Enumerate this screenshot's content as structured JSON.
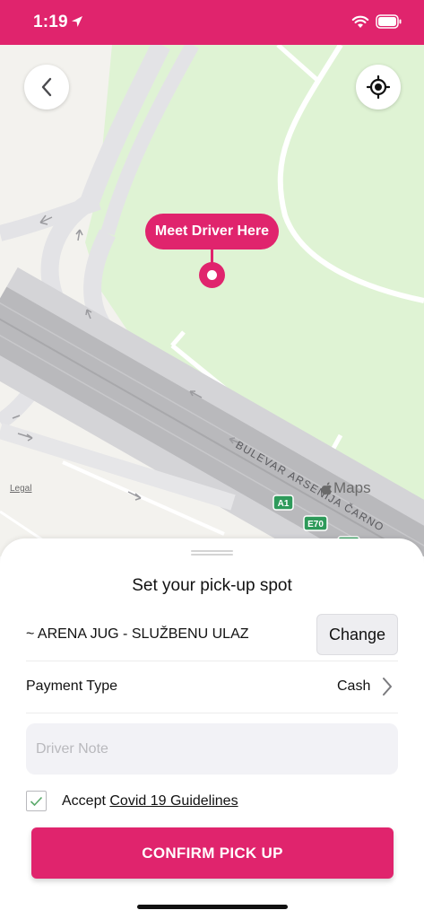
{
  "status_bar": {
    "time": "1:19",
    "background_color": "#e0246d"
  },
  "map": {
    "marker_label": "Meet Driver Here",
    "legal_label": "Legal",
    "brand_label": "Maps",
    "road_label": "BULEVAR ARSENIJA ČARNO",
    "road_shields": [
      "A1",
      "E70"
    ],
    "back_icon": "chevron-left-icon",
    "locate_icon": "crosshair-icon",
    "colors": {
      "park": "#dff3d4",
      "land": "#f3f2ee",
      "highway": "#bdbdc0",
      "road": "#e6e6e8"
    }
  },
  "sheet": {
    "title": "Set your pick-up spot",
    "pickup_spot": "~ ARENA JUG - SLUŽBENU ULAZ",
    "change_label": "Change",
    "payment_label": "Payment Type",
    "payment_value": "Cash",
    "driver_note": {
      "value": "",
      "placeholder": "Driver Note"
    },
    "covid": {
      "checked": true,
      "prefix": "Accept",
      "link": "Covid 19 Guidelines"
    },
    "confirm_label": "CONFIRM PICK UP"
  },
  "accent_color": "#e0246d"
}
